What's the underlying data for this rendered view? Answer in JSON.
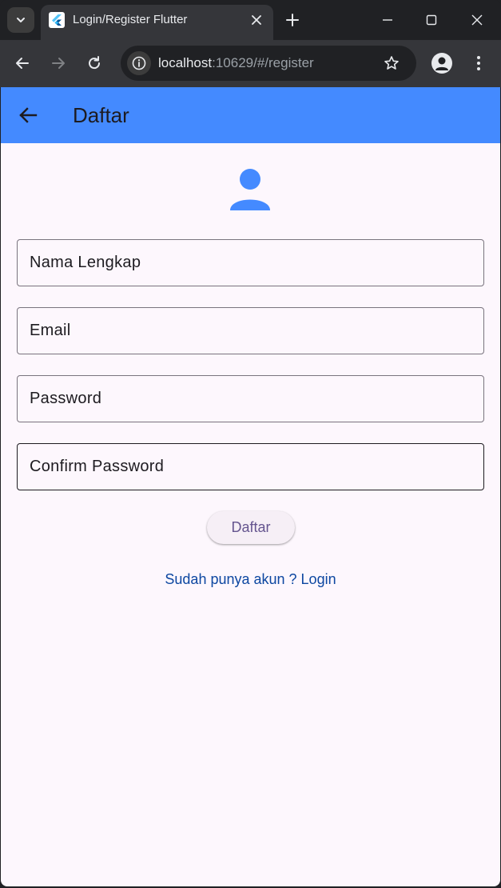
{
  "browser": {
    "tab": {
      "title": "Login/Register Flutter",
      "favicon": "flutter-logo"
    },
    "address_bar": {
      "host": "localhost",
      "path": ":10629/#/register"
    },
    "icons": {
      "tab_search": "chevron-down-icon",
      "tab_close": "close-icon",
      "new_tab": "plus-icon",
      "minimize": "minimize-icon",
      "maximize": "maximize-icon",
      "close_window": "close-icon",
      "back": "arrow-left-icon",
      "forward": "arrow-right-icon",
      "reload": "reload-icon",
      "site_info": "info-icon",
      "bookmark": "star-icon",
      "profile": "person-icon",
      "menu": "more-vertical-icon"
    }
  },
  "app": {
    "appbar": {
      "title": "Daftar",
      "back_icon": "arrow-left-icon",
      "color": "#448aff"
    },
    "header_icon": {
      "name": "person-icon",
      "color": "#448aff"
    },
    "form": {
      "fields": [
        {
          "label": "Nama Lengkap",
          "value": ""
        },
        {
          "label": "Email",
          "value": ""
        },
        {
          "label": "Password",
          "value": ""
        },
        {
          "label": "Confirm Password",
          "value": ""
        }
      ],
      "submit_label": "Daftar"
    },
    "login_link": "Sudah punya akun ? Login",
    "background_color": "#fdf7fd"
  }
}
